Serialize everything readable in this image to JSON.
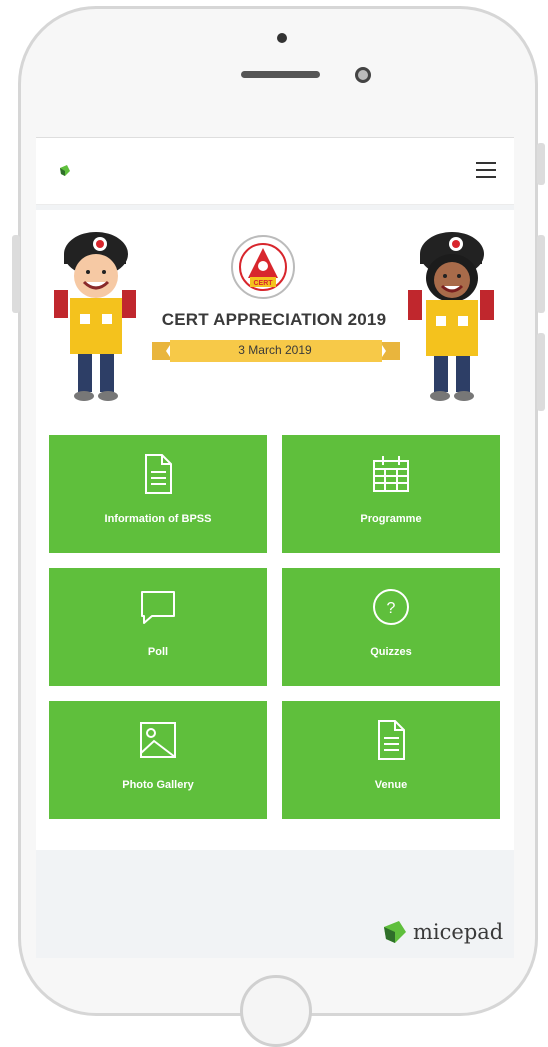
{
  "header": {
    "logo_icon": "micepad-leaf-icon",
    "menu_icon": "hamburger-menu-icon"
  },
  "banner": {
    "badge_text": "CERT",
    "title": "CERT APPRECIATION 2019",
    "date": "3 March 2019"
  },
  "tiles": [
    {
      "label": "Information of BPSS",
      "icon": "document-icon"
    },
    {
      "label": "Programme",
      "icon": "calendar-icon"
    },
    {
      "label": "Poll",
      "icon": "chat-bubble-icon"
    },
    {
      "label": "Quizzes",
      "icon": "question-circle-icon"
    },
    {
      "label": "Photo Gallery",
      "icon": "image-icon"
    },
    {
      "label": "Venue",
      "icon": "document-icon"
    }
  ],
  "footer": {
    "brand": "micepad"
  },
  "colors": {
    "tile_green": "#5fbf3c",
    "ribbon_yellow": "#f7c948"
  }
}
